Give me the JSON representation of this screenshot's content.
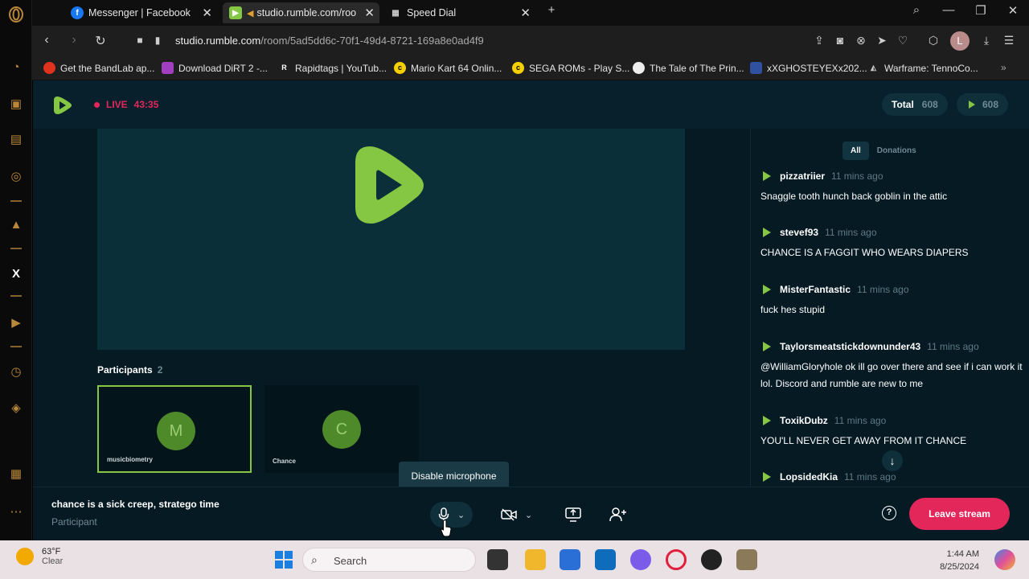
{
  "browser": {
    "tabs": [
      {
        "title": "Messenger | Facebook",
        "icon": "facebook-icon"
      },
      {
        "title": "studio.rumble.com/roo",
        "icon": "rumble-icon"
      },
      {
        "title": "Speed Dial",
        "icon": "speed-dial-icon"
      }
    ],
    "url_host": "studio.rumble.com",
    "url_path": "/room/5ad5dd6c-70f1-49d4-8721-169a8e0ad4f9",
    "profile_initial": "L",
    "bookmarks": [
      "Get the BandLab ap...",
      "Download DiRT 2 -...",
      "Rapidtags | YouTub...",
      "Mario Kart 64 Onlin...",
      "SEGA ROMs - Play S...",
      "The Tale of The Prin...",
      "xXGHOSTEYEXx202...",
      "Warframe: TennoCo..."
    ]
  },
  "studio": {
    "live_label": "LIVE",
    "live_time": "43:35",
    "total_label": "Total",
    "total_count": "608",
    "rumble_count": "608",
    "participants_label": "Participants",
    "participants_count": "2",
    "participants": [
      {
        "initial": "M",
        "name": "musicbiometry"
      },
      {
        "initial": "C",
        "name": "Chance"
      }
    ],
    "chat_filters": [
      "All",
      "Donations"
    ],
    "chat": [
      {
        "user": "pizzatriier",
        "ago": "11 mins ago",
        "text": "Snaggle tooth hunch back goblin in the attic"
      },
      {
        "user": "stevef93",
        "ago": "11 mins ago",
        "text": "CHANCE IS A FAGGIT WHO WEARS DIAPERS"
      },
      {
        "user": "MisterFantastic",
        "ago": "11 mins ago",
        "text": "fuck hes stupid"
      },
      {
        "user": "Taylorsmeatstickdownunder43",
        "ago": "11 mins ago",
        "text": "@WilliamGloryhole ok ill go over there and see if i can work it lol. Discord and rumble are new to me"
      },
      {
        "user": "ToxikDubz",
        "ago": "11 mins ago",
        "text": "YOU'LL NEVER GET AWAY FROM IT CHANCE"
      },
      {
        "user": "LopsidedKia",
        "ago": "11 mins ago",
        "text": ""
      }
    ],
    "tooltip": "Disable microphone",
    "stream_title": "chance is a sick creep, stratego time",
    "role": "Participant",
    "leave_label": "Leave stream",
    "colors": {
      "brand_green": "#85c742",
      "live_red": "#e3275b",
      "background": "#061a24"
    }
  },
  "taskbar": {
    "temperature": "63°F",
    "condition": "Clear",
    "search_label": "Search",
    "time": "1:44 AM",
    "date": "8/25/2024"
  }
}
